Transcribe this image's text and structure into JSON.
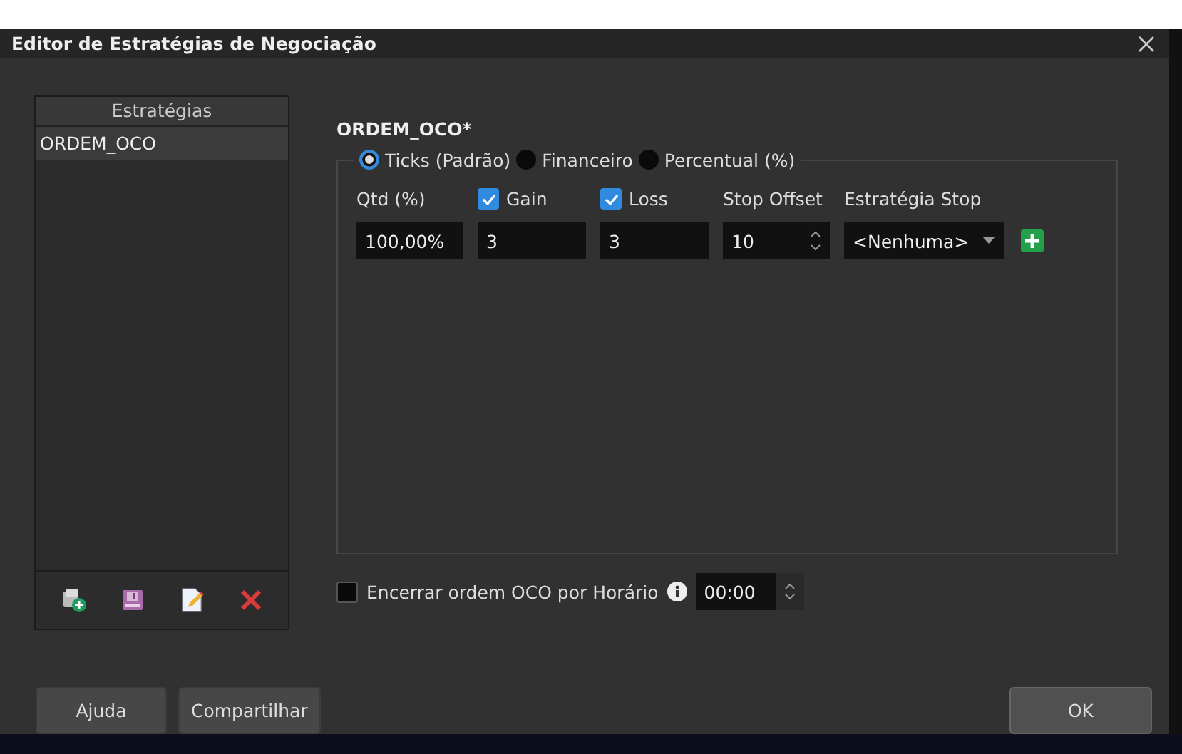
{
  "window": {
    "title": "Editor de Estratégias de Negociação"
  },
  "strategies": {
    "header": "Estratégias",
    "items": [
      {
        "label": "ORDEM_OCO",
        "selected": true
      }
    ]
  },
  "strategy": {
    "name": "ORDEM_OCO*"
  },
  "modes": [
    {
      "label": "Ticks (Padrão)",
      "selected": true
    },
    {
      "label": "Financeiro",
      "selected": false
    },
    {
      "label": "Percentual (%)",
      "selected": false
    }
  ],
  "fields": [
    {
      "kind": "text",
      "label": "Qtd (%)",
      "value": "100,00%"
    },
    {
      "kind": "check",
      "label": "Gain",
      "checked": true,
      "value": "3"
    },
    {
      "kind": "check",
      "label": "Loss",
      "checked": true,
      "value": "3"
    },
    {
      "kind": "spinner",
      "label": "Stop Offset",
      "value": "10"
    },
    {
      "kind": "dropdown",
      "label": "Estratégia Stop",
      "value": "<Nenhuma>"
    }
  ],
  "close_by_time": {
    "label": "Encerrar ordem OCO por Horário",
    "checked": false,
    "value": "00:00"
  },
  "left_buttons": [
    "Ajuda",
    "Compartilhar"
  ],
  "ok_button": "OK"
}
